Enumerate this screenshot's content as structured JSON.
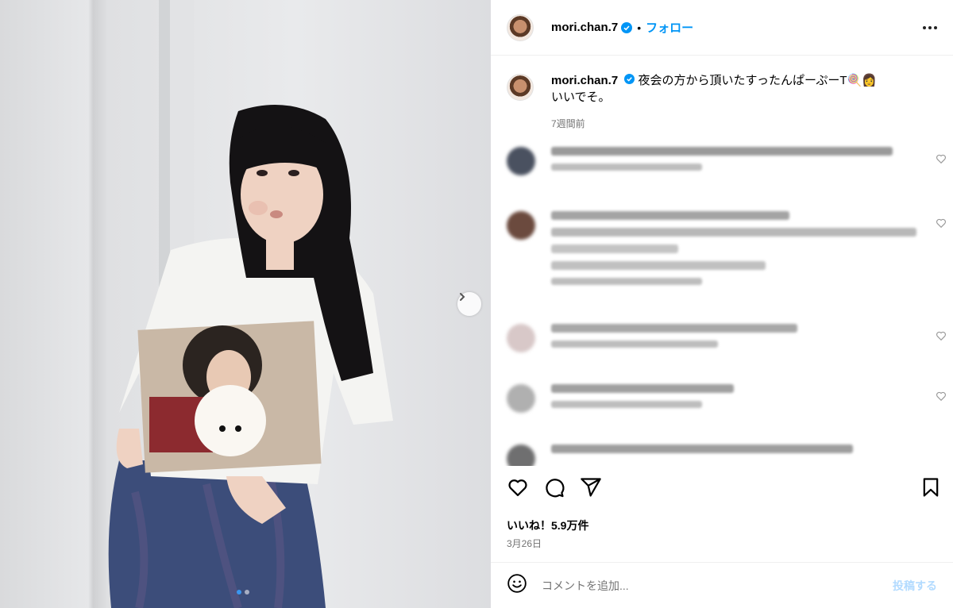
{
  "post": {
    "username": "mori.chan.7",
    "follow_label": "フォロー",
    "separator": "•",
    "caption_text": "夜会の方から頂いたすったんぱーぷーT🍭👩",
    "caption_line2": "いいでそ。",
    "caption_time": "7週間前",
    "likes": "いいね！5.9万件",
    "date": "3月26日",
    "comment_placeholder": "コメントを追加...",
    "post_label": "投稿する"
  },
  "carousel": {
    "current": 1,
    "total": 2
  },
  "icons": {
    "verified": "verified-badge-icon",
    "more": "more-options-icon",
    "like": "heart-icon",
    "comment": "comment-icon",
    "share": "send-icon",
    "save": "bookmark-icon",
    "emoji": "emoji-icon",
    "next": "chevron-right-icon"
  },
  "colors": {
    "accent": "#0095f6",
    "muted": "#737373",
    "post_disabled": "#b3dbff"
  }
}
